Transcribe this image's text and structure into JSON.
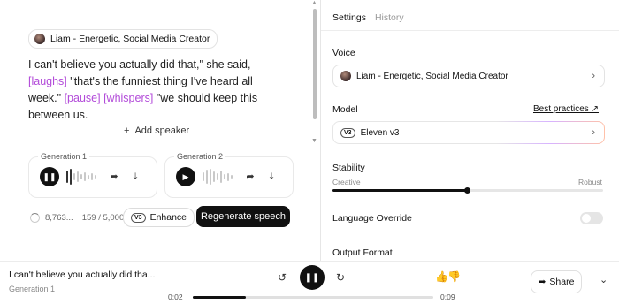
{
  "speaker_chip": "Liam - Energetic, Social Media Creator",
  "script": {
    "line1": "I can't believe you actually did that,\" she said,",
    "tag1": "[laughs]",
    "line2": "\"that's the funniest thing I've heard all",
    "line3": "week.\"",
    "tag2": "[pause]",
    "tag3": "[whispers]",
    "line4": "\"we should keep this",
    "line5": "between us."
  },
  "add_speaker": "Add speaker",
  "generations": [
    {
      "label": "Generation 1",
      "state": "pause"
    },
    {
      "label": "Generation 2",
      "state": "play"
    }
  ],
  "credits": "8,763...",
  "char_count": "159 / 5,000",
  "enhance": {
    "badge": "V3",
    "label": "Enhance"
  },
  "regenerate_label": "Regenerate speech",
  "right_panel": {
    "tabs": [
      "Settings",
      "History"
    ],
    "voice_label": "Voice",
    "voice_value": "Liam - Energetic, Social Media Creator",
    "model_label": "Model",
    "best_practices": "Best practices ↗",
    "model_badge": "V3",
    "model_value": "Eleven v3",
    "stability_label": "Stability",
    "stability_min": "Creative",
    "stability_max": "Robust",
    "stability_value": 0.5,
    "language_override": "Language Override",
    "output_format": "Output Format"
  },
  "player": {
    "title": "I can't believe you actually did tha...",
    "subtitle": "Generation 1",
    "time_current": "0:02",
    "time_total": "0:09",
    "progress": 0.22,
    "share_label": "Share"
  }
}
